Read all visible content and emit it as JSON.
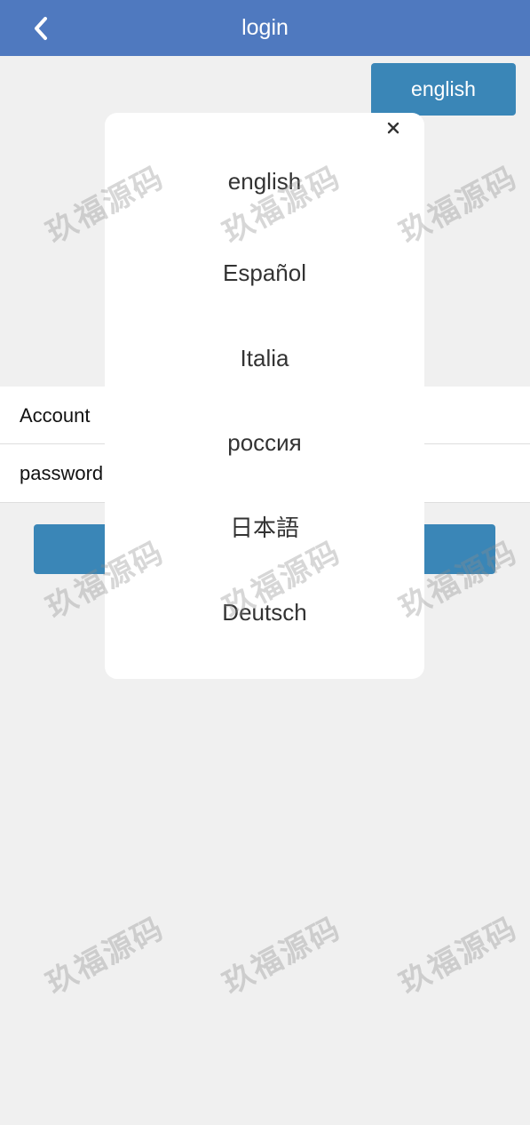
{
  "header": {
    "title": "login",
    "back_icon": "chevron-left-icon"
  },
  "language_button": {
    "label": "english"
  },
  "form": {
    "account_label": "Account",
    "password_label": "password"
  },
  "language_modal": {
    "close_icon": "close-icon",
    "options": [
      "english",
      "Español",
      "Italia",
      "россия",
      "日本語",
      "Deutsch"
    ]
  },
  "watermark": {
    "text": "玖福源码"
  },
  "colors": {
    "header_bg": "#4f79bf",
    "button_bg": "#3a86b7",
    "page_bg": "#f0f0f0",
    "option_text": "#333333"
  }
}
